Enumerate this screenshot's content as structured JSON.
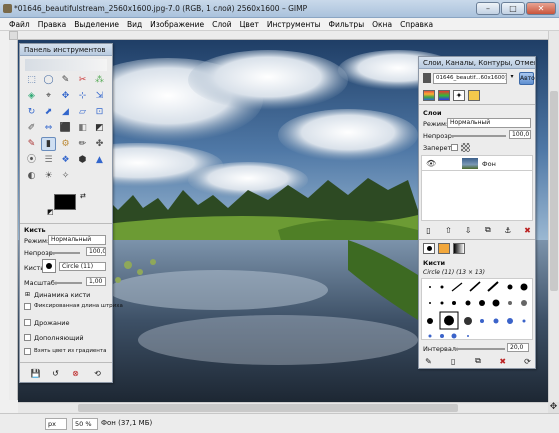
{
  "window": {
    "title": "*01646_beautifulstream_2560x1600.jpg-7.0 (RGB, 1 слой) 2560x1600 – GIMP",
    "minimize": "–",
    "maximize": "□",
    "close": "✕"
  },
  "menu": [
    "Файл",
    "Правка",
    "Выделение",
    "Вид",
    "Изображение",
    "Слой",
    "Цвет",
    "Инструменты",
    "Фильтры",
    "Окна",
    "Справка"
  ],
  "toolbox": {
    "title": "Панель инструментов",
    "tool_icons": [
      "⬚",
      "◯",
      "✎",
      "✂",
      "⁂",
      "◈",
      "⌖",
      "✥",
      "⊹",
      "⇲",
      "↻",
      "⬈",
      "◢",
      "▱",
      "⊡",
      "✐",
      "⇔",
      "⬛",
      "◧",
      "◩",
      "✎",
      "▮",
      "⚙",
      "✏",
      "✤",
      "⦿",
      "☰",
      "❖",
      "⬢",
      "▲",
      "◐",
      "☀",
      "✧"
    ],
    "options_title": "Кисть",
    "mode_label": "Режим:",
    "mode_value": "Нормальный",
    "opacity_label": "Непрозр.",
    "opacity_value": "100,0",
    "brush_label": "Кисть:",
    "brush_value": "Circle (11)",
    "scale_label": "Масштаб:",
    "scale_value": "1,00",
    "opt_dynamics": "Динамика кисти",
    "opt_fixed": "Фиксированная длина штриха",
    "opt_jitter": "Дрожание",
    "opt_incremental": "Дополняющий",
    "opt_gradient": "Взять цвет из градиента"
  },
  "layers": {
    "title": "Слои, Каналы, Контуры, Отмени...",
    "image_select": "01646_beautif...60x1600].jpg-7.0",
    "auto_button": "Авто",
    "section_title": "Слои",
    "mode_label": "Режим:",
    "mode_value": "Нормальный",
    "opacity_label": "Непрозр.",
    "opacity_value": "100,0",
    "lock_label": "Запереть:",
    "layer_name": "Фон",
    "brushes_title": "Кисти",
    "brush_info": "Circle (11) (13 × 13)",
    "spacing_label": "Интервал:",
    "spacing_value": "20,0"
  },
  "status": {
    "unit": "px",
    "zoom": "50 %",
    "info": "Фон (37,1 МБ)"
  }
}
